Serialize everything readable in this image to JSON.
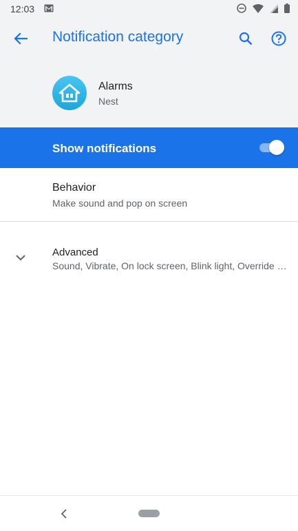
{
  "status_bar": {
    "time": "12:03"
  },
  "app_bar": {
    "title": "Notification category"
  },
  "app_info": {
    "name": "Alarms",
    "publisher": "Nest"
  },
  "show_notifications": {
    "label": "Show notifications",
    "enabled": true
  },
  "behavior": {
    "title": "Behavior",
    "subtitle": "Make sound and pop on screen"
  },
  "advanced": {
    "title": "Advanced",
    "subtitle": "Sound, Vibrate, On lock screen, Blink light, Override Do Not Disturb"
  },
  "colors": {
    "accent": "#1a73e8",
    "header_bg": "#f1f3f4",
    "toggle_track": "#8ab4f8"
  }
}
